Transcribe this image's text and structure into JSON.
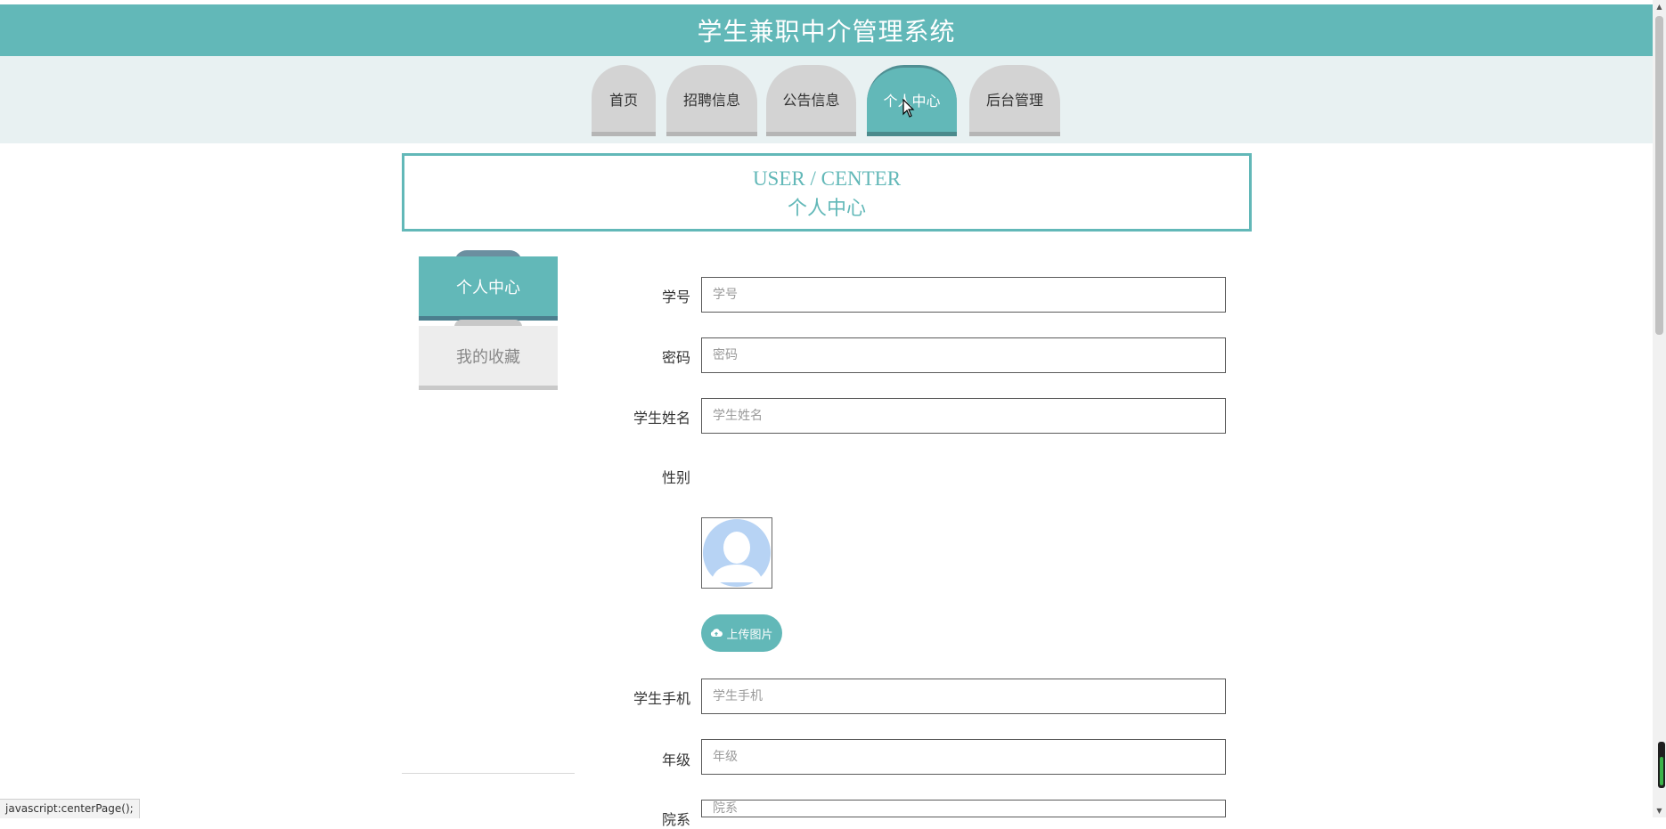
{
  "header": {
    "title": "学生兼职中介管理系统"
  },
  "nav": {
    "items": [
      {
        "label": "首页"
      },
      {
        "label": "招聘信息"
      },
      {
        "label": "公告信息"
      },
      {
        "label": "个人中心"
      },
      {
        "label": "后台管理"
      }
    ],
    "active": "个人中心"
  },
  "banner": {
    "en": "USER / CENTER",
    "cn": "个人中心"
  },
  "sidebar": {
    "items": [
      {
        "label": "个人中心"
      },
      {
        "label": "我的收藏"
      }
    ]
  },
  "form": {
    "fields": [
      {
        "label": "学号",
        "placeholder": "学号"
      },
      {
        "label": "密码",
        "placeholder": "密码"
      },
      {
        "label": "学生姓名",
        "placeholder": "学生姓名"
      },
      {
        "label": "性别"
      },
      {
        "label": "学生手机",
        "placeholder": "学生手机"
      },
      {
        "label": "年级",
        "placeholder": "年级"
      },
      {
        "label": "院系",
        "placeholder": "院系"
      }
    ],
    "upload_label": "上传图片"
  },
  "status": {
    "text": "javascript:centerPage();"
  },
  "colors": {
    "accent": "#62b8b8",
    "nav_bg": "#e8f1f2",
    "tab_inactive": "#d3d3d3"
  }
}
